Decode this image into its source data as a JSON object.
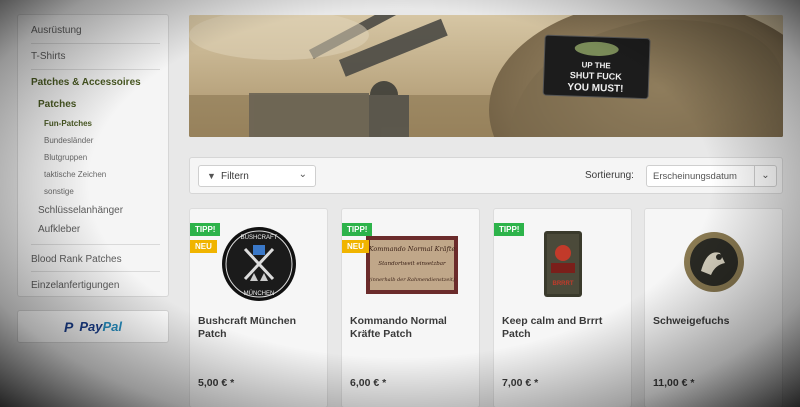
{
  "sidebar": {
    "items": [
      {
        "label": "Ausrüstung"
      },
      {
        "label": "T-Shirts"
      },
      {
        "label": "Patches & Accessoires"
      },
      {
        "label": "Patches"
      },
      {
        "label": "Fun-Patches"
      },
      {
        "label": "Bundesländer"
      },
      {
        "label": "Blutgruppen"
      },
      {
        "label": "taktische Zeichen"
      },
      {
        "label": "sonstige"
      },
      {
        "label": "Schlüsselanhänger"
      },
      {
        "label": "Aufkleber"
      },
      {
        "label": "Blood Rank Patches"
      },
      {
        "label": "Einzelanfertigungen"
      }
    ]
  },
  "paypal": {
    "mark": "P",
    "label_dark": "Pay",
    "label_light": "Pal"
  },
  "banner": {
    "helmet_patch_line1": "UP THE",
    "helmet_patch_line2": "SHUT FUCK",
    "helmet_patch_line3": "YOU MUST!"
  },
  "toolbar": {
    "filter_label": "Filtern",
    "sort_label": "Sortierung:",
    "sort_value": "Erscheinungsdatum"
  },
  "products": [
    {
      "name": "Bushcraft München Patch",
      "price": "5,00 € *",
      "badges": [
        "TIPP!",
        "NEU"
      ],
      "patch_text": "BUSHCRAFT MÜNCHEN"
    },
    {
      "name": "Kommando Normal Kräfte Patch",
      "price": "6,00 € *",
      "badges": [
        "TIPP!",
        "NEU"
      ],
      "patch_text": "Kommando Normal Kräfte"
    },
    {
      "name": "Keep calm and Brrrt Patch",
      "price": "7,00 € *",
      "badges": [
        "TIPP!"
      ],
      "patch_text": "BRRRT"
    },
    {
      "name": "Schweigefuchs",
      "price": "11,00 € *",
      "badges": [],
      "patch_text": ""
    }
  ],
  "colors": {
    "accent_green": "#4a5a23",
    "tipp": "#2db34a",
    "neu": "#f0b400",
    "paypal_dark": "#1b3f8e",
    "paypal_light": "#2790c3"
  }
}
